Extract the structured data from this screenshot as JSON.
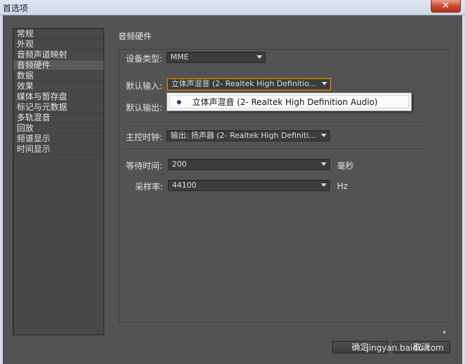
{
  "window": {
    "title": "首选项",
    "close_label": "✕"
  },
  "sidebar": {
    "items": [
      {
        "label": "常规"
      },
      {
        "label": "外观"
      },
      {
        "label": "音频声道映射"
      },
      {
        "label": "音频硬件",
        "selected": true
      },
      {
        "label": "数据"
      },
      {
        "label": "效果"
      },
      {
        "label": "媒体与暂存盘"
      },
      {
        "label": "标记与元数据"
      },
      {
        "label": "多轨混音"
      },
      {
        "label": "回放"
      },
      {
        "label": "频谱显示"
      },
      {
        "label": "时间显示"
      }
    ]
  },
  "main": {
    "section_title": "音频硬件",
    "device_type": {
      "label": "设备类型:",
      "value": "MME"
    },
    "default_input": {
      "label": "默认输入:",
      "value": "立体声混音 (2- Realtek High Definitio..."
    },
    "default_output": {
      "label": "默认输出:"
    },
    "master_clock": {
      "label": "主控时钟:",
      "value": "输出: 扬声器 (2- Realtek High Definiti..."
    },
    "latency": {
      "label": "等待时间:",
      "value": "200",
      "unit": "毫秒"
    },
    "sample_rate": {
      "label": "采样率:",
      "value": "44100",
      "unit": "Hz"
    }
  },
  "popup": {
    "options": [
      {
        "label": "立体声混音 (2- Realtek High Definition Audio)",
        "selected": true
      }
    ]
  },
  "footer": {
    "ok_label": "确定",
    "cancel_label": "取消",
    "watermark": "jingyan.baidu.com"
  },
  "colors": {
    "background": "#535353",
    "focus_accent": "#d48a14",
    "close_button": "#c7452f"
  }
}
